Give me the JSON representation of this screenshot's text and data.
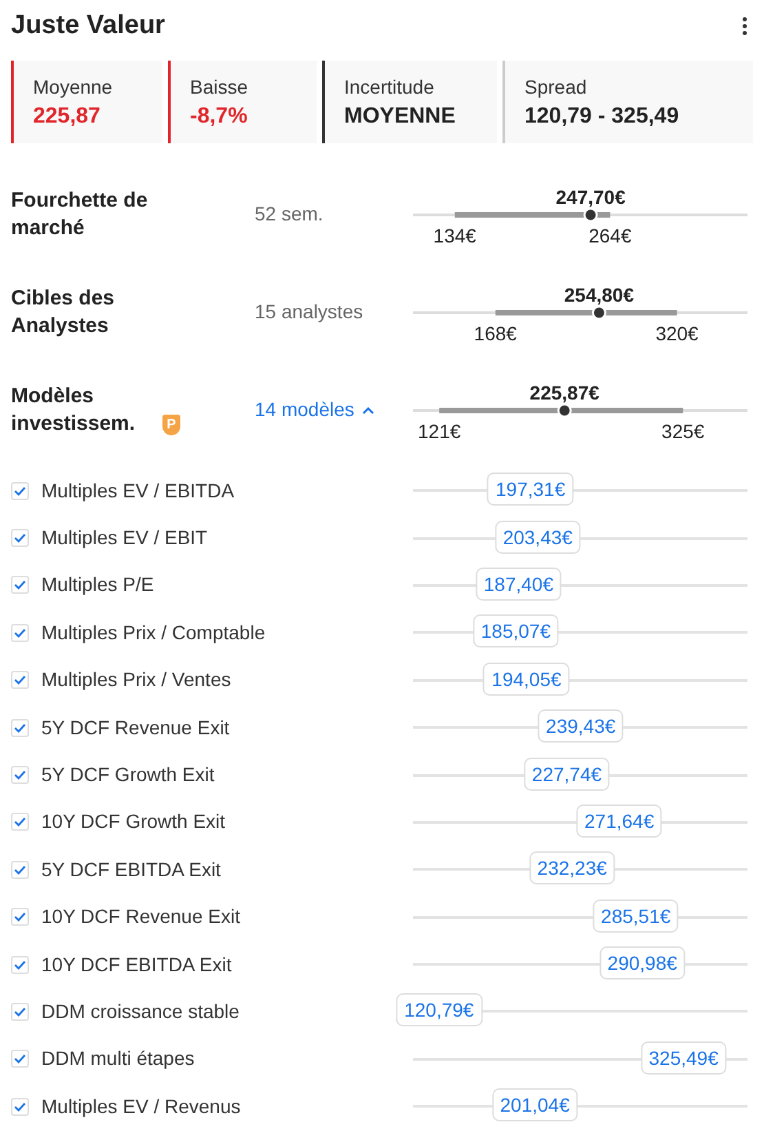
{
  "title": "Juste Valeur",
  "stats": [
    {
      "label": "Moyenne",
      "value": "225,87",
      "color": "#e0262b",
      "negative": true
    },
    {
      "label": "Baisse",
      "value": "-8,7%",
      "color": "#e0262b",
      "negative": true
    },
    {
      "label": "Incertitude",
      "value": "MOYENNE",
      "color": "#333333",
      "negative": false
    },
    {
      "label": "Spread",
      "value": "120,79 - 325,49",
      "color": "#cccccc",
      "negative": false
    }
  ],
  "ranges": [
    {
      "label": "Fourchette de marché",
      "kind": "text",
      "detail": "52 sem.",
      "value": "247,70€",
      "low": "134€",
      "high": "264€"
    },
    {
      "label": "Cibles des Analystes",
      "kind": "text",
      "detail": "15 analystes",
      "value": "254,80€",
      "low": "168€",
      "high": "320€"
    },
    {
      "label": "Modèles investissem.",
      "kind": "link",
      "pro_badge": "P",
      "detail": "14 modèles",
      "expanded": true,
      "value": "225,87€",
      "low": "121€",
      "high": "325€"
    }
  ],
  "models": [
    {
      "label": "Multiples EV / EBITDA",
      "checked": true,
      "value": "197,31€"
    },
    {
      "label": "Multiples EV / EBIT",
      "checked": true,
      "value": "203,43€"
    },
    {
      "label": "Multiples P/E",
      "checked": true,
      "value": "187,40€"
    },
    {
      "label": "Multiples Prix / Comptable",
      "checked": true,
      "value": "185,07€"
    },
    {
      "label": "Multiples Prix / Ventes",
      "checked": true,
      "value": "194,05€"
    },
    {
      "label": "5Y DCF Revenue Exit",
      "checked": true,
      "value": "239,43€"
    },
    {
      "label": "5Y DCF Growth Exit",
      "checked": true,
      "value": "227,74€"
    },
    {
      "label": "10Y DCF Growth Exit",
      "checked": true,
      "value": "271,64€"
    },
    {
      "label": "5Y DCF EBITDA Exit",
      "checked": true,
      "value": "232,23€"
    },
    {
      "label": "10Y DCF Revenue Exit",
      "checked": true,
      "value": "285,51€"
    },
    {
      "label": "10Y DCF EBITDA Exit",
      "checked": true,
      "value": "290,98€"
    },
    {
      "label": "DDM croissance stable",
      "checked": true,
      "value": "120,79€"
    },
    {
      "label": "DDM multi étapes",
      "checked": true,
      "value": "325,49€"
    },
    {
      "label": "Multiples EV / Revenus",
      "checked": true,
      "value": "201,04€"
    }
  ]
}
